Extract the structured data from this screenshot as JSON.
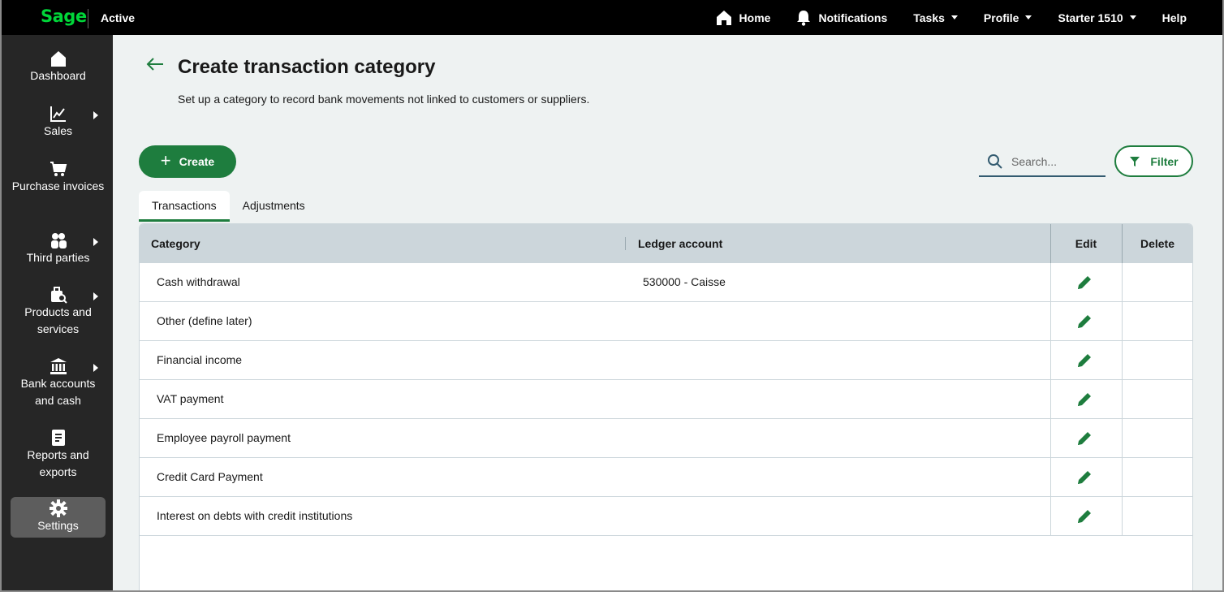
{
  "app": {
    "logo": "Sage",
    "status": "Active"
  },
  "topnav": {
    "home": "Home",
    "notifications": "Notifications",
    "tasks": "Tasks",
    "profile": "Profile",
    "company": "Starter 1510",
    "help": "Help"
  },
  "sidebar": {
    "items": [
      {
        "label": "Dashboard",
        "icon": "home-icon"
      },
      {
        "label": "Sales",
        "icon": "chart-line-icon"
      },
      {
        "label": "Purchase invoices",
        "icon": "cart-icon"
      },
      {
        "label": "Third parties",
        "icon": "users-icon"
      },
      {
        "label": "Products and services",
        "icon": "box-search-icon"
      },
      {
        "label": "Bank accounts and cash",
        "icon": "bank-icon"
      },
      {
        "label": "Reports and exports",
        "icon": "report-icon"
      },
      {
        "label": "Settings",
        "icon": "gear-icon"
      }
    ]
  },
  "page": {
    "title": "Create transaction category",
    "subtitle": "Set up a category to record bank movements not linked to customers or suppliers."
  },
  "toolbar": {
    "create_label": "Create",
    "search_placeholder": "Search...",
    "filter_label": "Filter"
  },
  "tabs": [
    {
      "label": "Transactions",
      "active": true
    },
    {
      "label": "Adjustments",
      "active": false
    }
  ],
  "table": {
    "headers": {
      "category": "Category",
      "ledger": "Ledger account",
      "edit": "Edit",
      "delete": "Delete"
    },
    "rows": [
      {
        "category": "Cash withdrawal",
        "ledger": "530000 - Caisse"
      },
      {
        "category": "Other (define later)",
        "ledger": ""
      },
      {
        "category": "Financial income",
        "ledger": ""
      },
      {
        "category": "VAT payment",
        "ledger": ""
      },
      {
        "category": "Employee payroll payment",
        "ledger": ""
      },
      {
        "category": "Credit Card Payment",
        "ledger": ""
      },
      {
        "category": "Interest on debts with credit institutions",
        "ledger": ""
      }
    ]
  },
  "colors": {
    "brand_green": "#00d639",
    "primary": "#1e7d3e",
    "sidebar_bg": "#262626",
    "header_bg": "#ccd6db"
  }
}
